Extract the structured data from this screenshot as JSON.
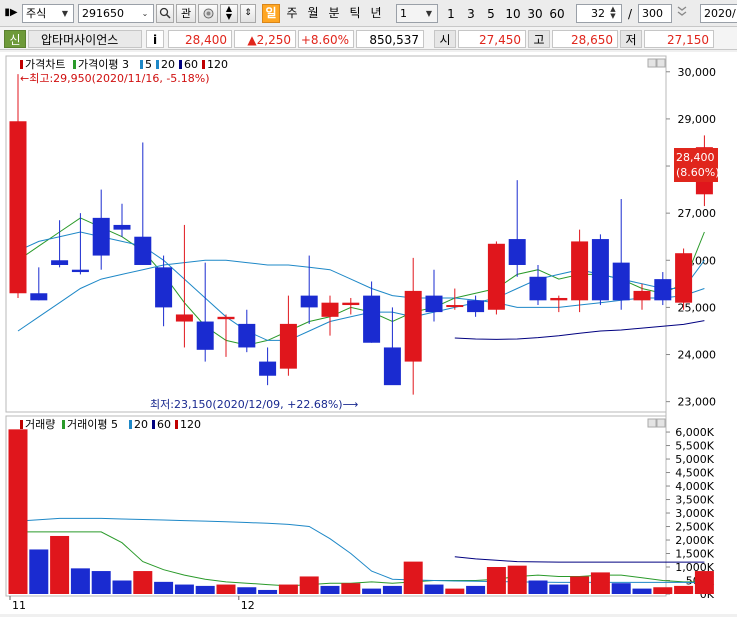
{
  "toolbar": {
    "market": "주식",
    "code": "291650",
    "btn_gwan": "관",
    "periods": [
      "일",
      "주",
      "월",
      "분",
      "틱",
      "년"
    ],
    "active_period": "일",
    "interval_value": "1",
    "intervals": [
      "1",
      "3",
      "5",
      "10",
      "30",
      "60"
    ],
    "count": "32",
    "slash": "/",
    "total": "300",
    "date": "2020/"
  },
  "quote": {
    "tag": "신",
    "name": "압타머사이언스",
    "info": "i",
    "price": "28,400",
    "change": "▲2,250",
    "change_pct": "+8.60%",
    "volume": "850,537",
    "open_label": "시",
    "open": "27,450",
    "high_label": "고",
    "high": "28,650",
    "low_label": "저",
    "low": "27,150"
  },
  "price_panel": {
    "legend": [
      {
        "text": "가격차트",
        "color": "#c00000"
      },
      {
        "text": "가격이평 3",
        "color": "#2a9a2a"
      },
      {
        "text": "5",
        "color": "#1e88c7"
      },
      {
        "text": "20",
        "color": "#1e88c7"
      },
      {
        "text": "60",
        "color": "#000080"
      },
      {
        "text": "120",
        "color": "#c00000"
      }
    ],
    "max_annotation": "←최고:29,950(2020/11/16,  -5.18%)",
    "min_annotation": "최저:23,150(2020/12/09,  +22.68%)⟶",
    "last_price_label": "28,400",
    "last_pct_label": "(8.60%)"
  },
  "volume_panel": {
    "legend": [
      {
        "text": "거래량",
        "color": "#c00000"
      },
      {
        "text": "거래이평 5",
        "color": "#2a9a2a"
      },
      {
        "text": "20",
        "color": "#1e88c7"
      },
      {
        "text": "60",
        "color": "#000080"
      },
      {
        "text": "120",
        "color": "#c00000"
      }
    ]
  },
  "chart_data": {
    "type": "candlestick",
    "price_axis": {
      "ticks": [
        "30,000",
        "29,000",
        "28,000",
        "27,000",
        "26,000",
        "25,000",
        "24,000",
        "23,000"
      ],
      "ylim": [
        22950,
        30250
      ]
    },
    "volume_axis": {
      "ticks": [
        "6,000K",
        "5,500K",
        "5,000K",
        "4,500K",
        "4,000K",
        "3,500K",
        "3,000K",
        "2,500K",
        "2,000K",
        "1,500K",
        "1,000K",
        "500K",
        "0K"
      ],
      "ylim": [
        0,
        6150
      ]
    },
    "x_labels": [
      {
        "index": 0,
        "text": "11"
      },
      {
        "index": 11,
        "text": "12"
      }
    ],
    "candles": [
      {
        "o": 25300,
        "h": 29950,
        "l": 25200,
        "c": 28950,
        "up": true
      },
      {
        "o": 25300,
        "h": 25850,
        "l": 25150,
        "c": 25150,
        "up": false
      },
      {
        "o": 25900,
        "h": 26850,
        "l": 25850,
        "c": 26000,
        "up": false
      },
      {
        "o": 25800,
        "h": 27000,
        "l": 25700,
        "c": 25750,
        "up": false
      },
      {
        "o": 26100,
        "h": 27500,
        "l": 25800,
        "c": 26900,
        "up": false
      },
      {
        "o": 26750,
        "h": 27200,
        "l": 26500,
        "c": 26650,
        "up": false
      },
      {
        "o": 26500,
        "h": 28500,
        "l": 25900,
        "c": 25900,
        "up": false
      },
      {
        "o": 25850,
        "h": 26100,
        "l": 24600,
        "c": 25000,
        "up": false
      },
      {
        "o": 24850,
        "h": 26750,
        "l": 24150,
        "c": 24700,
        "up": true
      },
      {
        "o": 24700,
        "h": 25950,
        "l": 23850,
        "c": 24100,
        "up": false
      },
      {
        "o": 24750,
        "h": 24850,
        "l": 23950,
        "c": 24800,
        "up": true
      },
      {
        "o": 24650,
        "h": 24950,
        "l": 24050,
        "c": 24150,
        "up": false
      },
      {
        "o": 23850,
        "h": 24150,
        "l": 23350,
        "c": 23550,
        "up": false
      },
      {
        "o": 23700,
        "h": 25250,
        "l": 23550,
        "c": 24650,
        "up": true
      },
      {
        "o": 25250,
        "h": 26100,
        "l": 24650,
        "c": 25000,
        "up": false
      },
      {
        "o": 24800,
        "h": 25250,
        "l": 24400,
        "c": 25100,
        "up": true
      },
      {
        "o": 25100,
        "h": 25200,
        "l": 24850,
        "c": 25050,
        "up": true
      },
      {
        "o": 25250,
        "h": 25550,
        "l": 24250,
        "c": 24250,
        "up": false
      },
      {
        "o": 24150,
        "h": 25000,
        "l": 23400,
        "c": 23350,
        "up": false
      },
      {
        "o": 23850,
        "h": 26050,
        "l": 23150,
        "c": 25350,
        "up": true
      },
      {
        "o": 25250,
        "h": 25800,
        "l": 24700,
        "c": 24900,
        "up": false
      },
      {
        "o": 25050,
        "h": 25400,
        "l": 24950,
        "c": 25050,
        "up": true
      },
      {
        "o": 25150,
        "h": 25250,
        "l": 24800,
        "c": 24900,
        "up": false
      },
      {
        "o": 24950,
        "h": 26400,
        "l": 24850,
        "c": 26350,
        "up": true
      },
      {
        "o": 26450,
        "h": 27700,
        "l": 25650,
        "c": 25900,
        "up": false
      },
      {
        "o": 25650,
        "h": 25900,
        "l": 25050,
        "c": 25150,
        "up": false
      },
      {
        "o": 25150,
        "h": 25250,
        "l": 24900,
        "c": 25200,
        "up": true
      },
      {
        "o": 25150,
        "h": 26650,
        "l": 24900,
        "c": 26400,
        "up": true
      },
      {
        "o": 26450,
        "h": 26550,
        "l": 25050,
        "c": 25150,
        "up": false
      },
      {
        "o": 25950,
        "h": 27300,
        "l": 24950,
        "c": 25150,
        "up": false
      },
      {
        "o": 25150,
        "h": 25500,
        "l": 24950,
        "c": 25350,
        "up": true
      },
      {
        "o": 25600,
        "h": 25750,
        "l": 25050,
        "c": 25150,
        "up": false
      },
      {
        "o": 25100,
        "h": 26250,
        "l": 24950,
        "c": 26150,
        "up": true
      },
      {
        "o": 27400,
        "h": 28650,
        "l": 27150,
        "c": 28400,
        "up": true
      }
    ],
    "ma_price": [
      {
        "name": "3",
        "color": "#2a9a2a",
        "values": [
          26000,
          26300,
          26600,
          26900,
          26700,
          26500,
          26200,
          25700,
          25100,
          24600,
          24300,
          24200,
          24300,
          24500,
          24700,
          24800,
          25000,
          24900,
          24700,
          24900,
          25000,
          25200,
          25300,
          25400,
          25700,
          25800,
          25600,
          25700,
          25700,
          25600,
          25400,
          25300,
          25500,
          26600
        ]
      },
      {
        "name": "5",
        "color": "#1e88c7",
        "values": [
          26200,
          26400,
          26500,
          26600,
          26500,
          26400,
          26300,
          26000,
          25600,
          25200,
          24800,
          24500,
          24300,
          24300,
          24500,
          24700,
          24800,
          24900,
          24900,
          24800,
          24900,
          25000,
          25100,
          25200,
          25400,
          25600,
          25700,
          25800,
          25700,
          25600,
          25500,
          25400,
          25400,
          26000
        ]
      },
      {
        "name": "20",
        "color": "#1e88c7",
        "values": [
          24500,
          24800,
          25100,
          25400,
          25600,
          25700,
          25800,
          25900,
          25950,
          26000,
          26000,
          25950,
          25900,
          25900,
          25850,
          25800,
          25600,
          25400,
          25250,
          25200,
          25200,
          25200,
          25150,
          25100,
          25000,
          25000,
          25000,
          25050,
          25100,
          25150,
          25200,
          25200,
          25250,
          25400
        ]
      },
      {
        "name": "60",
        "color": "#000080",
        "values": [
          null,
          null,
          null,
          null,
          null,
          null,
          null,
          null,
          null,
          null,
          null,
          null,
          null,
          null,
          null,
          null,
          null,
          null,
          null,
          null,
          null,
          24350,
          24330,
          24320,
          24330,
          24360,
          24400,
          24450,
          24500,
          24520,
          24560,
          24600,
          24640,
          24720
        ]
      }
    ],
    "volume": [
      {
        "v": 6100,
        "up": true
      },
      {
        "v": 1650,
        "up": false
      },
      {
        "v": 2150,
        "up": true
      },
      {
        "v": 950,
        "up": false
      },
      {
        "v": 850,
        "up": false
      },
      {
        "v": 500,
        "up": false
      },
      {
        "v": 850,
        "up": true
      },
      {
        "v": 450,
        "up": false
      },
      {
        "v": 350,
        "up": false
      },
      {
        "v": 300,
        "up": false
      },
      {
        "v": 350,
        "up": true
      },
      {
        "v": 250,
        "up": false
      },
      {
        "v": 150,
        "up": false
      },
      {
        "v": 350,
        "up": true
      },
      {
        "v": 650,
        "up": true
      },
      {
        "v": 300,
        "up": false
      },
      {
        "v": 400,
        "up": true
      },
      {
        "v": 200,
        "up": false
      },
      {
        "v": 300,
        "up": false
      },
      {
        "v": 1200,
        "up": true
      },
      {
        "v": 350,
        "up": false
      },
      {
        "v": 200,
        "up": true
      },
      {
        "v": 300,
        "up": false
      },
      {
        "v": 1000,
        "up": true
      },
      {
        "v": 1050,
        "up": true
      },
      {
        "v": 500,
        "up": false
      },
      {
        "v": 350,
        "up": false
      },
      {
        "v": 650,
        "up": true
      },
      {
        "v": 800,
        "up": true
      },
      {
        "v": 400,
        "up": false
      },
      {
        "v": 200,
        "up": false
      },
      {
        "v": 250,
        "up": true
      },
      {
        "v": 300,
        "up": true
      },
      {
        "v": 850,
        "up": true
      }
    ],
    "ma_volume": [
      {
        "name": "5",
        "color": "#2a9a2a",
        "values": [
          2300,
          2300,
          2300,
          2300,
          2300,
          1900,
          1200,
          900,
          700,
          550,
          450,
          400,
          350,
          300,
          350,
          400,
          400,
          450,
          400,
          450,
          500,
          500,
          500,
          550,
          650,
          700,
          650,
          650,
          700,
          700,
          600,
          500,
          450,
          450
        ]
      },
      {
        "name": "20",
        "color": "#1e88c7",
        "values": [
          2700,
          2750,
          2800,
          2800,
          2800,
          2780,
          2760,
          2740,
          2720,
          2700,
          2680,
          2650,
          2620,
          2580,
          2500,
          2050,
          1500,
          850,
          550,
          520,
          500,
          480,
          470,
          460,
          450,
          440,
          430,
          430,
          430,
          430,
          430,
          430,
          430,
          420
        ]
      },
      {
        "name": "60",
        "color": "#000080",
        "values": [
          null,
          null,
          null,
          null,
          null,
          null,
          null,
          null,
          null,
          null,
          null,
          null,
          null,
          null,
          null,
          null,
          null,
          null,
          null,
          null,
          null,
          1380,
          1300,
          1250,
          1200,
          1190,
          1180,
          1180,
          1180,
          1180,
          1180,
          1180,
          1180,
          1180
        ]
      }
    ]
  }
}
